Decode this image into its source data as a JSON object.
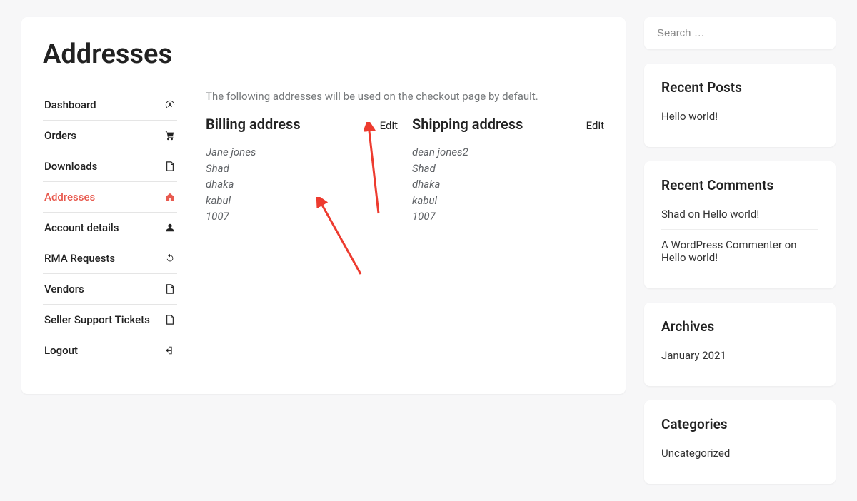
{
  "page_title": "Addresses",
  "nav": [
    {
      "label": "Dashboard",
      "icon": "gauge"
    },
    {
      "label": "Orders",
      "icon": "cart"
    },
    {
      "label": "Downloads",
      "icon": "file"
    },
    {
      "label": "Addresses",
      "icon": "home",
      "active": true
    },
    {
      "label": "Account details",
      "icon": "user"
    },
    {
      "label": "RMA Requests",
      "icon": "undo"
    },
    {
      "label": "Vendors",
      "icon": "file"
    },
    {
      "label": "Seller Support Tickets",
      "icon": "file"
    },
    {
      "label": "Logout",
      "icon": "logout"
    }
  ],
  "intro": "The following addresses will be used on the checkout page by default.",
  "billing": {
    "title": "Billing address",
    "edit": "Edit",
    "lines": [
      "Jane jones",
      "Shad",
      "dhaka",
      "kabul",
      "1007"
    ]
  },
  "shipping": {
    "title": "Shipping address",
    "edit": "Edit",
    "lines": [
      "dean jones2",
      "Shad",
      "dhaka",
      "kabul",
      "1007"
    ]
  },
  "search": {
    "placeholder": "Search …"
  },
  "recent_posts": {
    "title": "Recent Posts",
    "items": [
      {
        "text": "Hello world!"
      }
    ]
  },
  "recent_comments": {
    "title": "Recent Comments",
    "items": [
      {
        "author": "Shad",
        "on": " on ",
        "post": "Hello world!"
      },
      {
        "author": "A WordPress Commenter",
        "on": " on ",
        "post": "Hello world!"
      }
    ]
  },
  "archives": {
    "title": "Archives",
    "items": [
      {
        "text": "January 2021"
      }
    ]
  },
  "categories": {
    "title": "Categories",
    "items": [
      {
        "text": "Uncategorized"
      }
    ]
  }
}
